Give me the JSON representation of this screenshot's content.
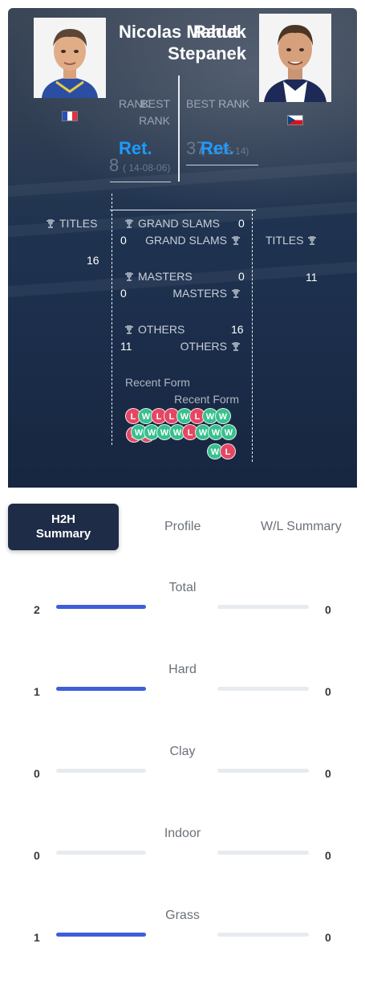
{
  "player1": {
    "first_name": "Nicolas",
    "last_name": "Mahut",
    "country": "France",
    "rank_label": "RANK",
    "rank_value": "Ret.",
    "best_rank_label_1": "BEST",
    "best_rank_label_2": "RANK",
    "best_rank_value": "37",
    "best_rank_date": "( 13-05-14)",
    "titles": "16",
    "grand_slams": "0",
    "masters": "0",
    "others": "16",
    "recent_form": [
      "L",
      "W",
      "L",
      "L",
      "W",
      "L",
      "W",
      "W",
      "L",
      "L"
    ]
  },
  "player2": {
    "first_name": "Radek",
    "last_name": "Stepanek",
    "country": "Czech Republic",
    "rank_label": "RANK",
    "rank_value": "Ret.",
    "best_rank_label_1": "BEST",
    "best_rank_label_2": "RANK",
    "best_rank_value": "8",
    "best_rank_date": "( 14-08-06)",
    "titles": "11",
    "grand_slams": "0",
    "masters": "0",
    "others": "11",
    "recent_form": [
      "W",
      "W",
      "W",
      "W",
      "L",
      "W",
      "W",
      "W",
      "W",
      "L"
    ]
  },
  "labels": {
    "titles": "TITLES",
    "grand_slams": "GRAND SLAMS",
    "masters": "MASTERS",
    "others": "OTHERS",
    "recent_form": "Recent Form"
  },
  "tabs": [
    "H2H Summary",
    "Profile",
    "W/L Summary"
  ],
  "summary": [
    {
      "label": "Total",
      "p1": 2,
      "p2": 0,
      "p1_fraction": 1.0,
      "p2_fraction": 0.0
    },
    {
      "label": "Hard",
      "p1": 1,
      "p2": 0,
      "p1_fraction": 1.0,
      "p2_fraction": 0.0
    },
    {
      "label": "Clay",
      "p1": 0,
      "p2": 0,
      "p1_fraction": 0.0,
      "p2_fraction": 0.0
    },
    {
      "label": "Indoor",
      "p1": 0,
      "p2": 0,
      "p1_fraction": 0.0,
      "p2_fraction": 0.0
    },
    {
      "label": "Grass",
      "p1": 1,
      "p2": 0,
      "p1_fraction": 1.0,
      "p2_fraction": 0.0
    }
  ],
  "colors": {
    "win": "#37c08d",
    "loss": "#e54763",
    "accent": "#1e9bff",
    "bar": "#3d5fd8"
  }
}
